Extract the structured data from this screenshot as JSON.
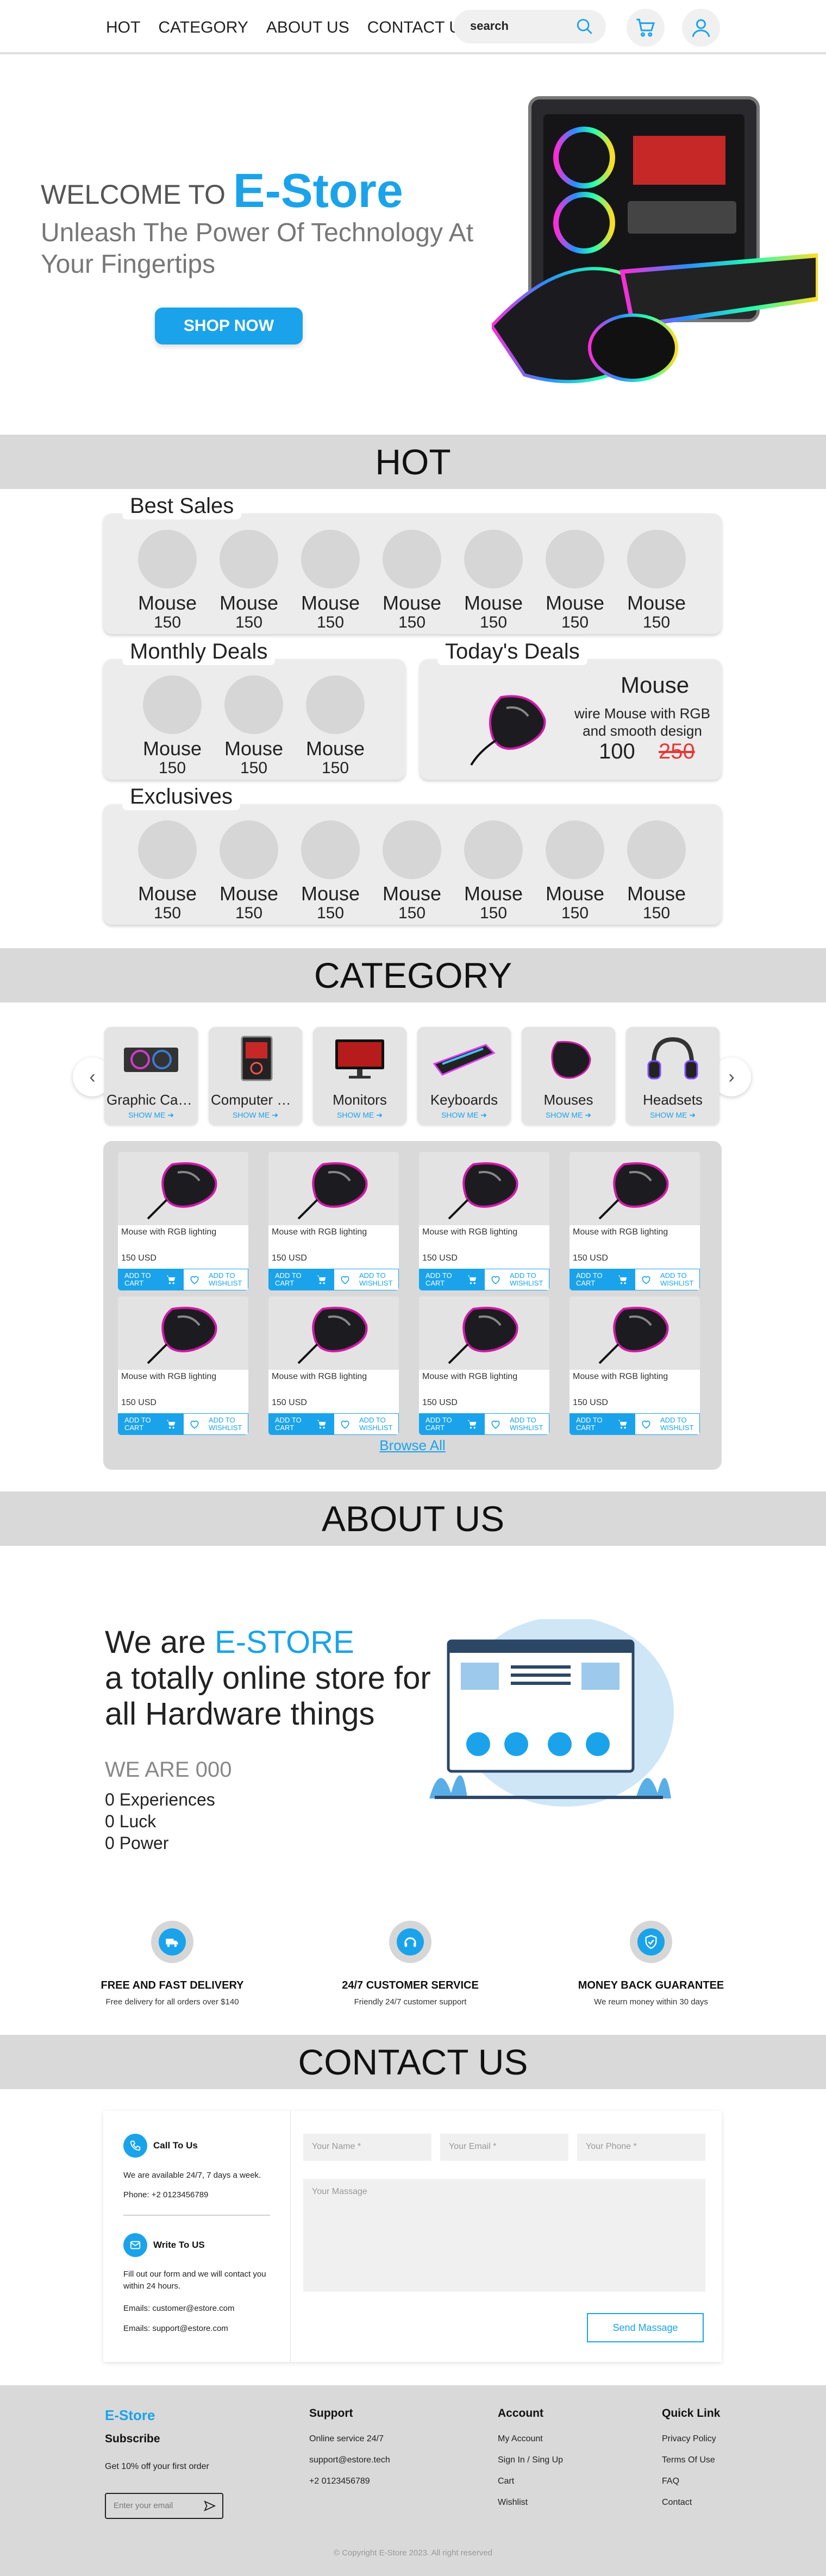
{
  "nav": {
    "items": [
      "HOT",
      "CATEGORY",
      "ABOUT US",
      "CONTACT US"
    ],
    "search_value": "search"
  },
  "hero": {
    "welcome": "WELCOME TO",
    "brand": "E-Store",
    "subtitle": "Unleash The Power Of Technology At Your Fingertips",
    "cta": "SHOP NOW"
  },
  "hot": {
    "title": "HOT",
    "best_sales": {
      "title": "Best Sales",
      "items": [
        {
          "name": "Mouse",
          "price": "150"
        },
        {
          "name": "Mouse",
          "price": "150"
        },
        {
          "name": "Mouse",
          "price": "150"
        },
        {
          "name": "Mouse",
          "price": "150"
        },
        {
          "name": "Mouse",
          "price": "150"
        },
        {
          "name": "Mouse",
          "price": "150"
        },
        {
          "name": "Mouse",
          "price": "150"
        }
      ]
    },
    "monthly_deals": {
      "title": "Monthly Deals",
      "items": [
        {
          "name": "Mouse",
          "price": "150"
        },
        {
          "name": "Mouse",
          "price": "150"
        },
        {
          "name": "Mouse",
          "price": "150"
        }
      ]
    },
    "todays_deals": {
      "title": "Today's Deals",
      "name": "Mouse",
      "description": "wire Mouse with RGB and smooth design",
      "price": "100",
      "old_price": "250"
    },
    "exclusives": {
      "title": "Exclusives",
      "items": [
        {
          "name": "Mouse",
          "price": "150"
        },
        {
          "name": "Mouse",
          "price": "150"
        },
        {
          "name": "Mouse",
          "price": "150"
        },
        {
          "name": "Mouse",
          "price": "150"
        },
        {
          "name": "Mouse",
          "price": "150"
        },
        {
          "name": "Mouse",
          "price": "150"
        },
        {
          "name": "Mouse",
          "price": "150"
        }
      ]
    }
  },
  "category": {
    "title": "CATEGORY",
    "show_more": "SHOW ME",
    "items": [
      {
        "label": "Graphic Cards",
        "icon": "gpu-icon"
      },
      {
        "label": "Computer Ca...",
        "icon": "pc-case-icon"
      },
      {
        "label": "Monitors",
        "icon": "monitor-icon"
      },
      {
        "label": "Keyboards",
        "icon": "keyboard-icon"
      },
      {
        "label": "Mouses",
        "icon": "mouse-icon"
      },
      {
        "label": "Headsets",
        "icon": "headset-icon"
      }
    ],
    "products": [
      {
        "title": "Mouse with RGB lighting",
        "price": "150 USD"
      },
      {
        "title": "Mouse with RGB lighting",
        "price": "150 USD"
      },
      {
        "title": "Mouse with RGB lighting",
        "price": "150 USD"
      },
      {
        "title": "Mouse with RGB lighting",
        "price": "150 USD"
      },
      {
        "title": "Mouse with RGB lighting",
        "price": "150 USD"
      },
      {
        "title": "Mouse with RGB lighting",
        "price": "150 USD"
      },
      {
        "title": "Mouse with RGB lighting",
        "price": "150 USD"
      },
      {
        "title": "Mouse with RGB lighting",
        "price": "150 USD"
      }
    ],
    "add_to_cart": "ADD TO CART",
    "add_to_wishlist": "ADD TO WISHLIST",
    "browse_all": "Browse All"
  },
  "about": {
    "title": "ABOUT US",
    "we_are": "We are",
    "brand": "E-STORE",
    "line2": "a totally online store for",
    "line3": "all Hardware things",
    "we_are_count": "WE ARE 000",
    "stats": [
      "0 Experiences",
      "0 Luck",
      "0 Power"
    ]
  },
  "features": [
    {
      "icon": "truck-icon",
      "title": "FREE AND FAST DELIVERY",
      "desc": "Free delivery for all orders over $140"
    },
    {
      "icon": "headset-icon",
      "title": "24/7 CUSTOMER SERVICE",
      "desc": "Friendly 24/7 customer support"
    },
    {
      "icon": "shield-check-icon",
      "title": "MONEY BACK GUARANTEE",
      "desc": "We reurn money within 30 days"
    }
  ],
  "contact": {
    "title": "CONTACT US",
    "call_head": "Call To Us",
    "call_text": "We are available 24/7, 7 days a week.",
    "call_phone": "Phone: +2 0123456789",
    "write_head": "Write To US",
    "write_text": "Fill out our form and we will contact you within 24 hours.",
    "email1": "Emails: customer@estore.com",
    "email2": "Emails: support@estore.com",
    "name_placeholder": "Your Name *",
    "email_placeholder": "Your Email *",
    "phone_placeholder": "Your Phone *",
    "message_placeholder": "Your Massage",
    "send": "Send Massage"
  },
  "footer": {
    "brand": "E-Store",
    "subscribe": "Subscribe",
    "discount": "Get 10% off your first order",
    "email_placeholder": "Enter your email",
    "support": {
      "head": "Support",
      "links": [
        "Online service 24/7",
        "support@estore.tech",
        "+2 0123456789"
      ]
    },
    "account": {
      "head": "Account",
      "links": [
        "My Account",
        "Sign In / Sing Up",
        "Cart",
        "Wishlist"
      ]
    },
    "quick": {
      "head": "Quick Link",
      "links": [
        "Privacy Policy",
        "Terms Of Use",
        "FAQ",
        "Contact"
      ]
    },
    "copyright": "Copyright E-Store 2023. All right reserved"
  },
  "colors": {
    "accent": "#1aa3ea",
    "section_bar": "#d9d9d9",
    "card_bg": "#ececec",
    "old_price": "#e53935"
  }
}
